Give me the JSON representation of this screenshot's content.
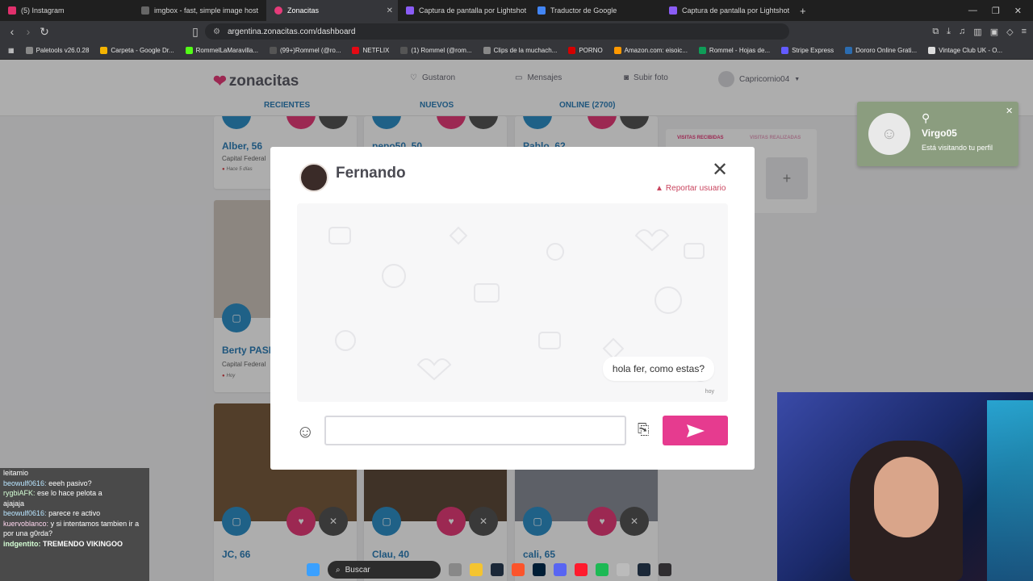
{
  "browser": {
    "tabs": [
      {
        "label": "(5) Instagram",
        "color": "#e1306c"
      },
      {
        "label": "imgbox - fast, simple image host",
        "color": "#444"
      },
      {
        "label": "Zonacitas",
        "color": "#e63b7a"
      },
      {
        "label": "Captura de pantalla por Lightshot",
        "color": "#8a5cf5"
      },
      {
        "label": "Traductor de Google",
        "color": "#4285f4"
      },
      {
        "label": "Captura de pantalla por Lightshot",
        "color": "#8a5cf5"
      }
    ],
    "url": "argentina.zonacitas.com/dashboard",
    "bookmarks": [
      {
        "label": "Paletools v26.0.28",
        "color": "#888"
      },
      {
        "label": "Carpeta - Google Dr...",
        "color": "#f4b400"
      },
      {
        "label": "RommelLaMaravilla...",
        "color": "#53fc18"
      },
      {
        "label": "(99+)Rommel (@ro...",
        "color": "#111"
      },
      {
        "label": "NETFLIX",
        "color": "#e50914"
      },
      {
        "label": "(1) Rommel (@rom...",
        "color": "#111"
      },
      {
        "label": "Clips de la muchach...",
        "color": "#666"
      },
      {
        "label": "PORNO",
        "color": "#d40000"
      },
      {
        "label": "Amazon.com: eisoic...",
        "color": "#ff9900"
      },
      {
        "label": "Rommel - Hojas de...",
        "color": "#0f9d58"
      },
      {
        "label": "Stripe Express",
        "color": "#635bff"
      },
      {
        "label": "Dororo Online Grati...",
        "color": "#2b6cb0"
      },
      {
        "label": "Vintage Club UK - O...",
        "color": "#333"
      }
    ]
  },
  "site": {
    "logo": "zonacitas",
    "nav": {
      "likes": "Gustaron",
      "messages": "Mensajes",
      "upload": "Subir foto",
      "user": "Capricornio04"
    },
    "subnav": {
      "recent": "RECIENTES",
      "new": "NUEVOS",
      "online": "ONLINE (2700)"
    },
    "cards_top": [
      {
        "name": "Alber, 56",
        "location": "Capital Federal",
        "status": "Hace 5 días"
      },
      {
        "name": "pepo50, 50",
        "location": "",
        "status": ""
      },
      {
        "name": "Pablo, 62",
        "location": "",
        "status": ""
      }
    ],
    "card_mid": {
      "name": "Berty PASIV",
      "location": "Capital Federal",
      "status": "Hoy"
    },
    "cards_bottom": [
      {
        "name": "JC, 66"
      },
      {
        "name": "Clau, 40"
      },
      {
        "name": "cali, 65"
      }
    ],
    "visits": {
      "received": "VISITAS RECIBIDAS",
      "made": "VISITAS REALIZADAS"
    }
  },
  "modal": {
    "name": "Fernando",
    "report": "Reportar usuario",
    "message": "hola fer, como estas?",
    "time": "hoy",
    "input_placeholder": ""
  },
  "notification": {
    "name": "Virgo05",
    "text": "Está visitando tu perfil"
  },
  "stream_chat": [
    {
      "user": "",
      "text": "leitamio"
    },
    {
      "user": "beowulf0616:",
      "text": "eeeh pasivo?"
    },
    {
      "user": "rygbiAFK:",
      "text": "ese lo hace pelota a"
    },
    {
      "user": "",
      "text": "ajajaja"
    },
    {
      "user": "beowulf0616:",
      "text": "parece re activo"
    },
    {
      "user": "kuervoblanco:",
      "text": "y si intentamos tambien ir a por una g0rda?"
    },
    {
      "user": "indgentito:",
      "text": "TREMENDO VIKINGOO"
    }
  ],
  "taskbar": {
    "search": "Buscar"
  }
}
